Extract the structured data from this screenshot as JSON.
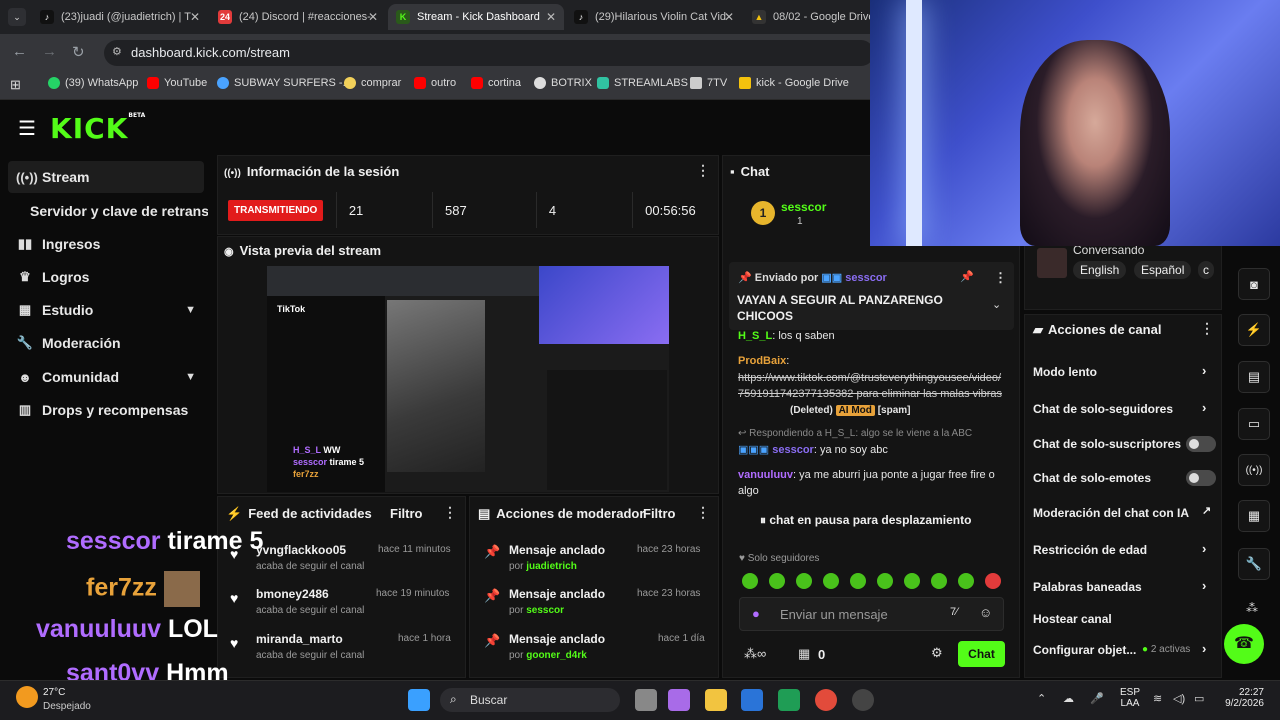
{
  "browser": {
    "tabs": [
      {
        "label": "(23)juadi (@juadietrich) | T",
        "fav": "♪",
        "color": "#111"
      },
      {
        "label": "(24) Discord | #reacciones-",
        "fav": "24",
        "color": "#e23b3b"
      },
      {
        "label": "Stream - Kick Dashboard",
        "fav": "K",
        "color": "#1f3f1f"
      },
      {
        "label": "(29)Hilarious Violin Cat Vid",
        "fav": "♪",
        "color": "#111"
      },
      {
        "label": "08/02 - Google Drive",
        "fav": "▲",
        "color": "#333"
      }
    ],
    "url": "dashboard.kick.com/stream",
    "bookmarks": [
      "(39) WhatsApp",
      "YouTube",
      "SUBWAY SURFERS -...",
      "comprar",
      "outro",
      "cortina",
      "BOTRIX",
      "STREAMLABS",
      "7TV",
      "kick - Google Drive"
    ]
  },
  "sidebar": {
    "logo": "KICK",
    "logo_badge": "BETA",
    "items": [
      {
        "label": "Stream",
        "icon": "((•))"
      },
      {
        "label": "Servidor y clave de retransmisión",
        "icon": ""
      },
      {
        "label": "Ingresos",
        "icon": "▮▮"
      },
      {
        "label": "Logros",
        "icon": "🏆"
      },
      {
        "label": "Estudio",
        "icon": "▦"
      },
      {
        "label": "Moderación",
        "icon": "🔧"
      },
      {
        "label": "Comunidad",
        "icon": "👥"
      },
      {
        "label": "Drops y recompensas",
        "icon": "▥"
      }
    ]
  },
  "session": {
    "title": "Información de la sesión",
    "status": "TRANSMITIENDO",
    "stat1": "21",
    "stat2": "587",
    "stat3": "4",
    "duration": "00:56:56"
  },
  "preview": {
    "title": "Vista previa del stream",
    "inner_site": "TikTok",
    "inner_chat_user": "H_S_L",
    "inner_chat_msg": "WW",
    "inner_chat_user2": "sesscor",
    "inner_chat_msg2": "tirame 5",
    "inner_chat_user3": "fer7zz"
  },
  "feed": {
    "title": "Feed de actividades",
    "filter": "Filtro",
    "rows": [
      {
        "name": "yvngflackkoo05",
        "sub": "acaba de seguir el canal",
        "time": "hace 11 minutos"
      },
      {
        "name": "bmoney2486",
        "sub": "acaba de seguir el canal",
        "time": "hace 19 minutos"
      },
      {
        "name": "miranda_marto",
        "sub": "acaba de seguir el canal",
        "time": "hace 1 hora"
      }
    ]
  },
  "modactions": {
    "title": "Acciones de moderador",
    "filter": "Filtro",
    "rows": [
      {
        "name": "Mensaje anclado",
        "by": "por",
        "user": "juadietrich",
        "time": "hace 23 horas"
      },
      {
        "name": "Mensaje anclado",
        "by": "por",
        "user": "sesscor",
        "time": "hace 23 horas"
      },
      {
        "name": "Mensaje anclado",
        "by": "por",
        "user": "gooner_d4rk",
        "time": "hace 1 día"
      }
    ]
  },
  "chat": {
    "title": "Chat",
    "top_user": "sesscor",
    "top_count": "1",
    "top_rank": "1",
    "pinned_label": "Enviado por",
    "pinned_user": "sesscor",
    "pinned_text": "VAYAN A SEGUIR AL PANZARENGO CHICOOS",
    "msgs": [
      {
        "user": "H_S_L",
        "text": ": los q saben"
      },
      {
        "user": "ProdBaix",
        "text": ":"
      },
      {
        "user": "",
        "text": "https://www.tiktok.com/@trusteverythingyousee/video/7591911742377135382 para eliminar las malas vibras"
      },
      {
        "user": "",
        "text": "(Deleted)"
      },
      {
        "user": "",
        "text": "AI Mod"
      },
      {
        "user": "",
        "text": "[spam]"
      },
      {
        "user": "",
        "text": "Respondiendo a H_S_L: algo se le viene a la ABC"
      },
      {
        "user": "sesscor",
        "text": ": ya no soy abc"
      },
      {
        "user": "vanuuluuv",
        "text": ": ya me aburri jua ponte a jugar free fire o algo"
      }
    ],
    "paused": "chat en pausa para desplazamiento",
    "followers_only": "Solo seguidores",
    "input_placeholder": "Enviar un mensaje",
    "viewers_count": "0",
    "send": "Chat"
  },
  "community": {
    "state": "Conversando",
    "langs": [
      "English",
      "Español",
      "c"
    ]
  },
  "channel_actions": {
    "title": "Acciones de canal",
    "items": [
      {
        "label": "Modo lento",
        "kind": "arrow"
      },
      {
        "label": "Chat de solo-seguidores",
        "kind": "arrow"
      },
      {
        "label": "Chat de solo-suscriptores",
        "kind": "toggle"
      },
      {
        "label": "Chat de solo-emotes",
        "kind": "toggle"
      },
      {
        "label": "Moderación del chat con IA",
        "kind": "external"
      },
      {
        "label": "Restricción de edad",
        "kind": "arrow"
      },
      {
        "label": "Palabras baneadas",
        "kind": "arrow"
      },
      {
        "label": "Hostear canal",
        "kind": "none"
      },
      {
        "label": "Configurar objet...",
        "kind": "arrow"
      }
    ],
    "active_count": "2 activas"
  },
  "overlay_chat": [
    {
      "user": "sesscor",
      "msg": "tirame 5",
      "color": "#b06cff"
    },
    {
      "user": "fer7zz",
      "msg": "",
      "color": "#e8a23a"
    },
    {
      "user": "vanuuluuv",
      "msg": "LOL",
      "color": "#b06cff"
    },
    {
      "user": "sant0vv",
      "msg": "Hmm",
      "color": "#b06cff"
    }
  ],
  "taskbar": {
    "weather_temp": "27°C",
    "weather_text": "Despejado",
    "search": "Buscar",
    "lang": "ESP",
    "lang2": "LAA",
    "time": "22:27",
    "date": "9/2/2026"
  },
  "colors": {
    "kick_green": "#53fc18",
    "live_red": "#e21b1b",
    "sub_purple": "#b06cff"
  }
}
